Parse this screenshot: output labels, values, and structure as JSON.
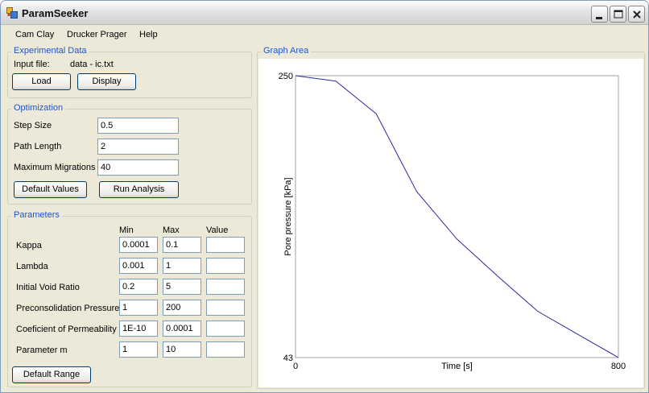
{
  "window": {
    "title": "ParamSeeker"
  },
  "menu": [
    "Cam Clay",
    "Drucker Prager",
    "Help"
  ],
  "experimental": {
    "title": "Experimental Data",
    "input_label": "Input file:",
    "input_file": "data - ic.txt",
    "load_label": "Load",
    "display_label": "Display"
  },
  "optimization": {
    "title": "Optimization",
    "fields": [
      {
        "label": "Step Size",
        "value": "0.5"
      },
      {
        "label": "Path Length",
        "value": "2"
      },
      {
        "label": "Maximum Migrations",
        "value": "40"
      }
    ],
    "default_values_label": "Default Values",
    "run_analysis_label": "Run Analysis"
  },
  "parameters": {
    "title": "Parameters",
    "headers": {
      "min": "Min",
      "max": "Max",
      "value": "Value"
    },
    "rows": [
      {
        "label": "Kappa",
        "min": "0.0001",
        "max": "0.1",
        "value": ""
      },
      {
        "label": "Lambda",
        "min": "0.001",
        "max": "1",
        "value": ""
      },
      {
        "label": "Initial Void Ratio",
        "min": "0.2",
        "max": "5",
        "value": ""
      },
      {
        "label": "Preconsolidation Pressure",
        "min": "1",
        "max": "200",
        "value": ""
      },
      {
        "label": "Coeficient of Permeability",
        "min": "1E-10",
        "max": "0.0001",
        "value": ""
      },
      {
        "label": "Parameter m",
        "min": "1",
        "max": "10",
        "value": ""
      }
    ],
    "default_range_label": "Default Range"
  },
  "graph": {
    "title": "Graph Area",
    "chart_data": {
      "type": "line",
      "xlabel": "Time [s]",
      "ylabel": "Pore pressure [kPa]",
      "xlim": [
        0,
        800
      ],
      "ylim": [
        43,
        250
      ],
      "x_tick_labels": [
        "0",
        "800"
      ],
      "y_tick_labels": [
        "250",
        "43"
      ],
      "series": [
        {
          "color": "#2b2ba0",
          "x": [
            0,
            100,
            200,
            300,
            400,
            500,
            600,
            700,
            800
          ],
          "y": [
            250,
            246,
            222,
            165,
            130,
            103,
            77,
            60,
            43
          ]
        }
      ]
    }
  }
}
